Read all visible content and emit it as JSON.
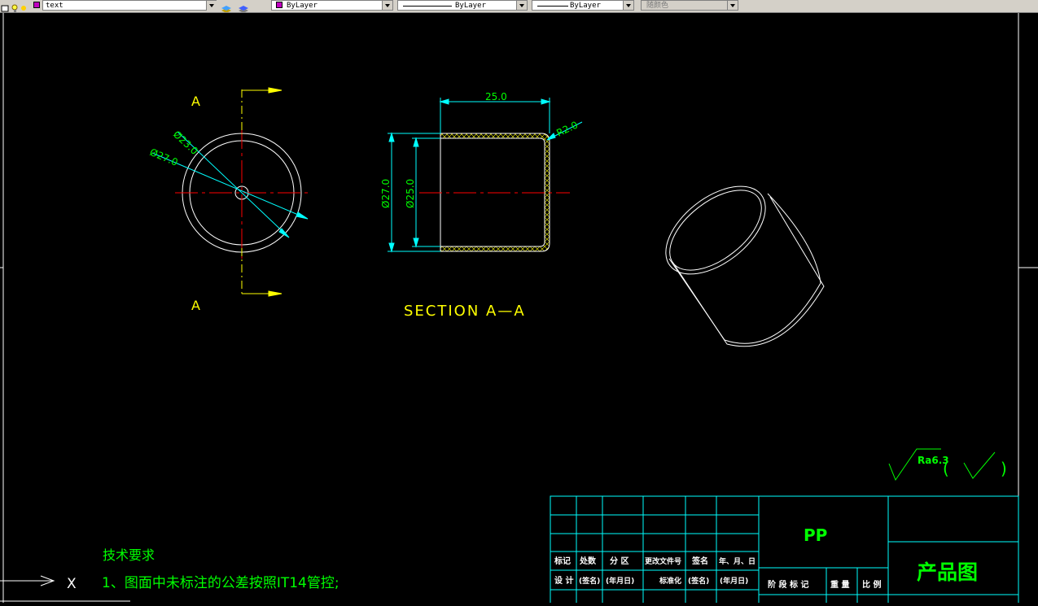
{
  "toolbar": {
    "layer_name": "text",
    "color_value": "ByLayer",
    "linetype_value": "ByLayer",
    "lineweight_value": "ByLayer",
    "plotstyle_value": "随颜色"
  },
  "colors": {
    "background": "#000000",
    "frame": "#ffffff",
    "geometry": "#ffffff",
    "annotation": "#ffff00",
    "dimension": "#00ffff",
    "dimension_text": "#00ff00",
    "centerline": "#ff0000",
    "swatch": "#c000c0"
  },
  "drawing": {
    "front_view": {
      "section_label_top": "A",
      "section_label_bottom": "A",
      "dim_inner": "Ø23.0",
      "dim_outer": "Ø27.0"
    },
    "section_view": {
      "dim_width": "25.0",
      "dim_radius": "R2.0",
      "dim_outer": "Ø27.0",
      "dim_inner": "Ø25.0",
      "title": "SECTION A—A"
    },
    "surface_finish": {
      "value": "Ra6.3",
      "paren_open": "(",
      "paren_close": ")"
    },
    "tech_requirements": {
      "heading": "技术要求",
      "item1": "1、图面中未标注的公差按照IT14管控;"
    },
    "ucs": {
      "axis_label": "X"
    },
    "title_block": {
      "material": "PP",
      "drawing_name": "产品图",
      "headers_row1": [
        "标记",
        "处数",
        "分 区",
        "更改文件号",
        "签名",
        "年、月、日"
      ],
      "headers_row2": [
        "设 计",
        "(签名)",
        "(年月日)",
        "标准化",
        "(签名)",
        "(年月日)"
      ],
      "stage_headers": [
        "阶 段 标 记",
        "重 量",
        "比 例"
      ]
    }
  }
}
